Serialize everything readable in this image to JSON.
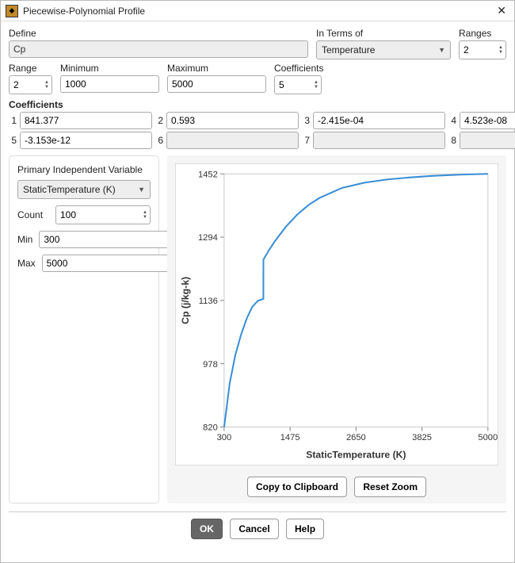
{
  "title": "Piecewise-Polynomial Profile",
  "closeGlyph": "✕",
  "labels": {
    "define": "Define",
    "inTerms": "In Terms of",
    "ranges": "Ranges",
    "range": "Range",
    "minimum": "Minimum",
    "maximum": "Maximum",
    "coef": "Coefficients",
    "coefHead": "Coefficients",
    "piv": "Primary Independent Variable",
    "count": "Count",
    "min": "Min",
    "max": "Max"
  },
  "define_value": "Cp",
  "inTerms_value": "Temperature",
  "ranges_value": "2",
  "range_value": "2",
  "minimum_value": "1000",
  "maximum_value": "5000",
  "coefCount_value": "5",
  "coef": {
    "1": "841.377",
    "2": "0.593",
    "3": "-2.415e-04",
    "4": "4.523e-08",
    "5": "-3.153e-12",
    "6": "",
    "7": "",
    "8": ""
  },
  "piv_value": "StaticTemperature (K)",
  "count_value": "100",
  "min_value": "300",
  "max_value": "5000",
  "buttons": {
    "copy": "Copy to Clipboard",
    "reset": "Reset Zoom",
    "ok": "OK",
    "cancel": "Cancel",
    "help": "Help"
  },
  "chart_data": {
    "type": "line",
    "xlabel": "StaticTemperature (K)",
    "ylabel": "Cp (j/kg-k)",
    "xlim": [
      300,
      5000
    ],
    "ylim": [
      820,
      1452
    ],
    "xticks": [
      300,
      1475,
      2650,
      3825,
      5000
    ],
    "yticks": [
      820,
      978,
      1136,
      1294,
      1452
    ],
    "series": [
      {
        "name": "Cp",
        "x": [
          300,
          400,
          500,
          600,
          700,
          800,
          900,
          999,
          1000,
          1100,
          1200,
          1400,
          1600,
          1800,
          2000,
          2400,
          2800,
          3200,
          3600,
          4000,
          4500,
          5000
        ],
        "y": [
          820,
          930,
          1000,
          1050,
          1090,
          1120,
          1135,
          1140,
          1238,
          1262,
          1283,
          1320,
          1350,
          1374,
          1392,
          1417,
          1430,
          1438,
          1443,
          1447,
          1450,
          1452
        ]
      }
    ],
    "color": "#3a8ed6"
  }
}
